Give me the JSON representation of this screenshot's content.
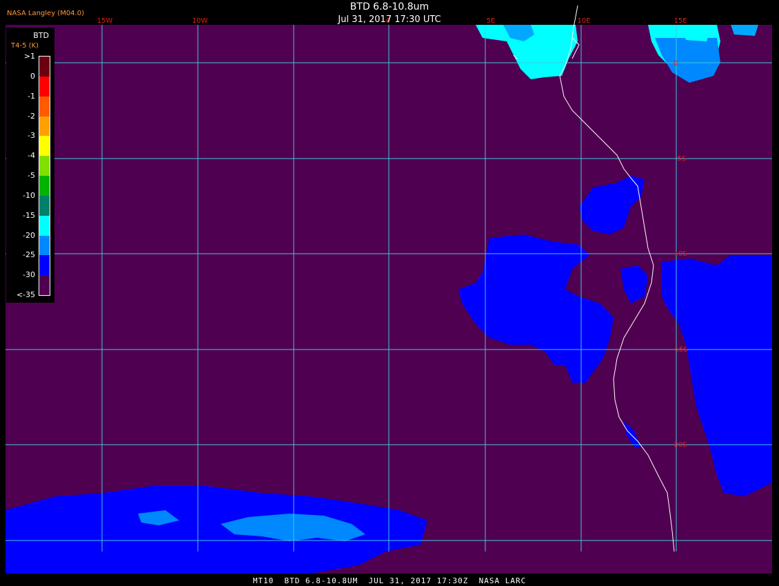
{
  "header": {
    "org": "NASA Langley (M04.0)",
    "title": "BTD 6.8-10.8um",
    "datetime": "Jul 31, 2017 17:30 UTC"
  },
  "footer": "MT10  BTD 6.8-10.8UM  JUL 31, 2017 17:30Z  NASA LARC",
  "legend": {
    "title": "BTD",
    "subtitle": "T4-5 (K)",
    "labels": [
      ">1",
      "0",
      "-1",
      "-2",
      "-3",
      "-4",
      "-5",
      "-10",
      "-15",
      "-20",
      "-25",
      "-30",
      "<-35"
    ],
    "colors": [
      "#6b0010",
      "#ff0000",
      "#ff5a00",
      "#ffa000",
      "#ffff00",
      "#80e000",
      "#00b400",
      "#00806a",
      "#00ffff",
      "#0088ff",
      "#0000ff",
      "#500050"
    ]
  },
  "map": {
    "background_color": "#500050",
    "grid_color": "#40c8e0",
    "coast_color": "#ffffff",
    "longitude_labels": [
      "15W",
      "10W",
      "0",
      "5E",
      "10E",
      "15E"
    ],
    "latitude_labels": [
      "5S",
      "10S",
      "15S",
      "20S"
    ],
    "north_label": "0"
  }
}
